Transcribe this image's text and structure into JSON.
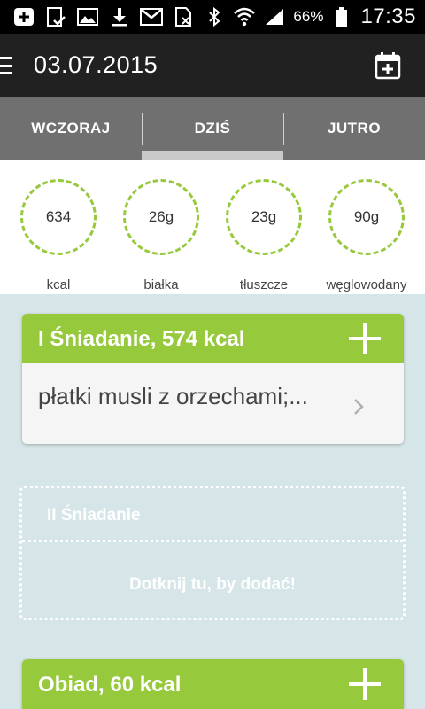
{
  "status_bar": {
    "icons": [
      "add-notification-icon",
      "clipboard-check-icon",
      "image-icon",
      "download-icon",
      "gmail-icon",
      "sim-icon",
      "bluetooth-icon",
      "wifi-icon",
      "signal-icon",
      "battery-icon"
    ],
    "battery": "66%",
    "time": "17:35"
  },
  "app_bar": {
    "title": "03.07.2015",
    "icons": [
      "menu-icon",
      "calendar-add-icon"
    ]
  },
  "tabs": [
    {
      "label": "WCZORAJ",
      "selected": false
    },
    {
      "label": "DZIŚ",
      "selected": true
    },
    {
      "label": "JUTRO",
      "selected": false
    }
  ],
  "summary": [
    {
      "value": "634",
      "label": "kcal"
    },
    {
      "value": "26g",
      "label": "białka"
    },
    {
      "value": "23g",
      "label": "tłuszcze"
    },
    {
      "value": "90g",
      "label": "węglowodany"
    }
  ],
  "meals": {
    "breakfast1": {
      "title": "I Śniadanie, 574 kcal",
      "items": "płatki musli z orzechami;..."
    },
    "breakfast2": {
      "title": "II Śniadanie",
      "hint": "Dotknij tu, by dodać!"
    },
    "lunch": {
      "title": "Obiad, 60 kcal"
    }
  },
  "colors": {
    "accent": "#97c93d",
    "app_bar": "#212121",
    "tabs": "#707070",
    "background": "#d6e5e7"
  }
}
